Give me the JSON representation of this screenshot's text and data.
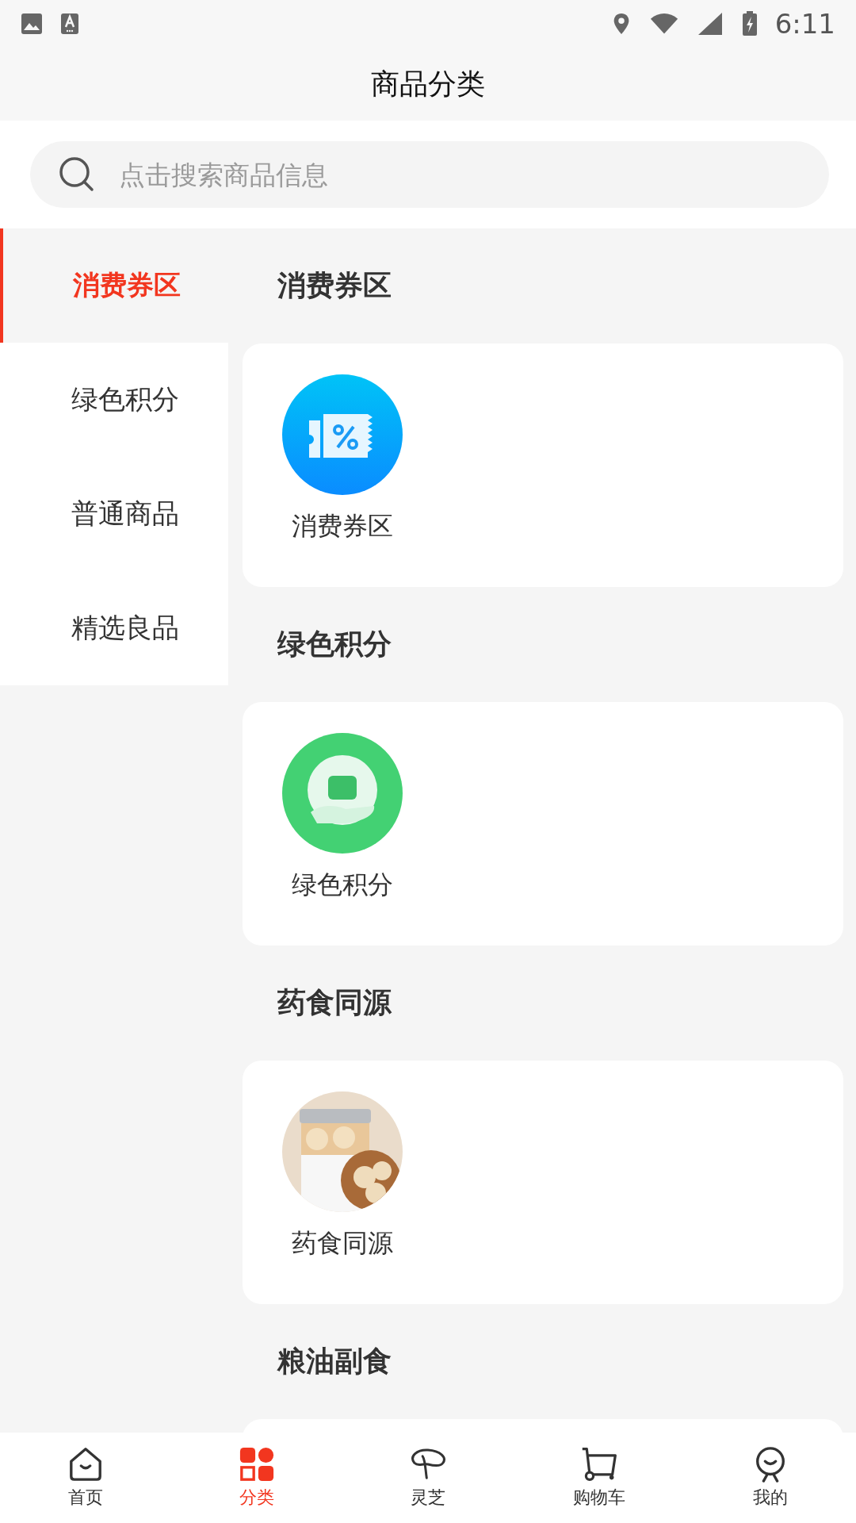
{
  "status_bar": {
    "time": "6:11"
  },
  "header": {
    "title": "商品分类"
  },
  "search": {
    "placeholder": "点击搜索商品信息"
  },
  "sidebar": {
    "items": [
      {
        "label": "消费券区",
        "selected": true
      },
      {
        "label": "绿色积分",
        "selected": false
      },
      {
        "label": "普通商品",
        "selected": false
      },
      {
        "label": "精选良品",
        "selected": false
      }
    ]
  },
  "sections": [
    {
      "title": "消费券区",
      "items": [
        {
          "label": "消费券区",
          "kind": "coupon"
        }
      ]
    },
    {
      "title": "绿色积分",
      "items": [
        {
          "label": "绿色积分",
          "kind": "points"
        }
      ]
    },
    {
      "title": "药食同源",
      "items": [
        {
          "label": "药食同源",
          "kind": "picture"
        }
      ]
    },
    {
      "title": "粮油副食"
    }
  ],
  "tab_bar": {
    "items": [
      {
        "label": "首页",
        "kind": "home",
        "selected": false
      },
      {
        "label": "分类",
        "kind": "category",
        "selected": true
      },
      {
        "label": "灵芝",
        "kind": "mushroom",
        "selected": false
      },
      {
        "label": "购物车",
        "kind": "cart",
        "selected": false
      },
      {
        "label": "我的",
        "kind": "me",
        "selected": false
      }
    ]
  }
}
